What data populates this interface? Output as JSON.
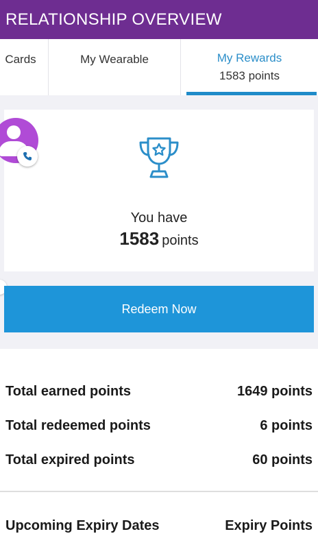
{
  "header": {
    "title": "RELATIONSHIP OVERVIEW"
  },
  "tabs": [
    {
      "label": "Cards"
    },
    {
      "label": "My Wearable"
    },
    {
      "label": "My Rewards",
      "sub": "1583 points",
      "active": true
    }
  ],
  "rewards": {
    "you_have_label": "You have",
    "points_value": "1583",
    "points_unit": "points",
    "redeem_label": "Redeem Now"
  },
  "summary": [
    {
      "label": "Total earned points",
      "value": "1649 points"
    },
    {
      "label": "Total redeemed points",
      "value": "6 points"
    },
    {
      "label": "Total expired points",
      "value": "60 points"
    }
  ],
  "expiry": {
    "dates_label": "Upcoming Expiry Dates",
    "points_label": "Expiry Points"
  },
  "colors": {
    "header_bg": "#6e2d91",
    "accent_blue": "#1e95d9",
    "avatar_purple": "#b04bd6"
  },
  "icons": {
    "trophy": "trophy-icon",
    "avatar": "user-avatar-icon",
    "call": "phone-icon"
  }
}
